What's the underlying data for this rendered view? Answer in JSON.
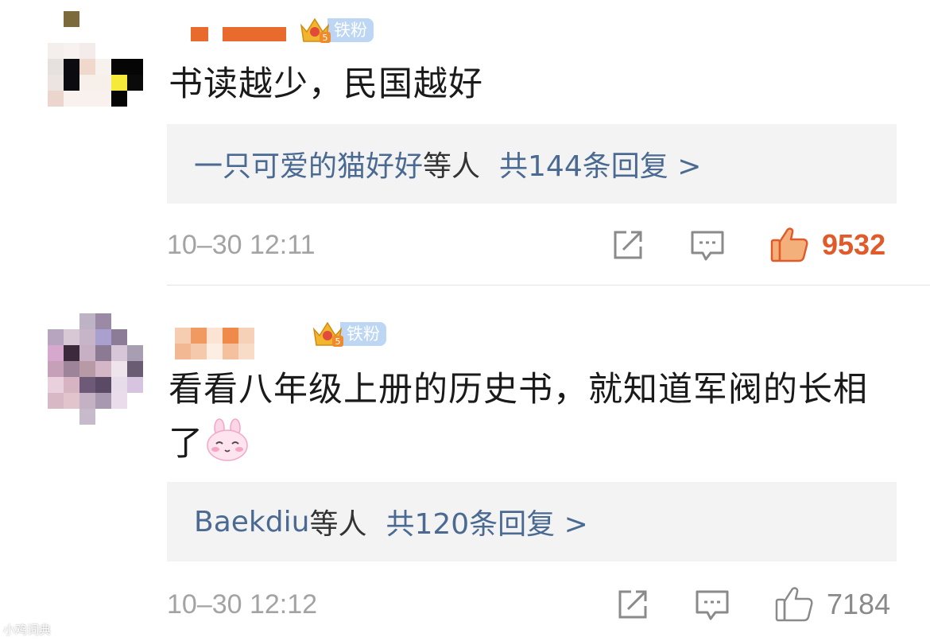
{
  "comments": [
    {
      "badge_label": "铁粉",
      "badge_level": "5",
      "text": "书读越少，民国越好",
      "reply_user": "一只可爱的猫好好",
      "reply_etc": "等人",
      "reply_total": "共144条回复 >",
      "time": "10–30 12:11",
      "likes": "9532",
      "liked": true
    },
    {
      "badge_label": "铁粉",
      "badge_level": "5",
      "text": "看看八年级上册的历史书，就知道军阀的长相了",
      "emoji": "bunny-blush-emoji",
      "reply_user": "Baekdiu",
      "reply_etc": "等人",
      "reply_total": "共120条回复 >",
      "time": "10–30 12:12",
      "likes": "7184",
      "liked": false
    }
  ],
  "watermark": "小鸡词典",
  "colors": {
    "link_blue": "#4a6a92",
    "like_orange": "#e05a2a",
    "reply_bg": "#f3f3f3",
    "timestamp_gray": "#a3a3a3",
    "badge_blue": "#bcd6f3"
  }
}
